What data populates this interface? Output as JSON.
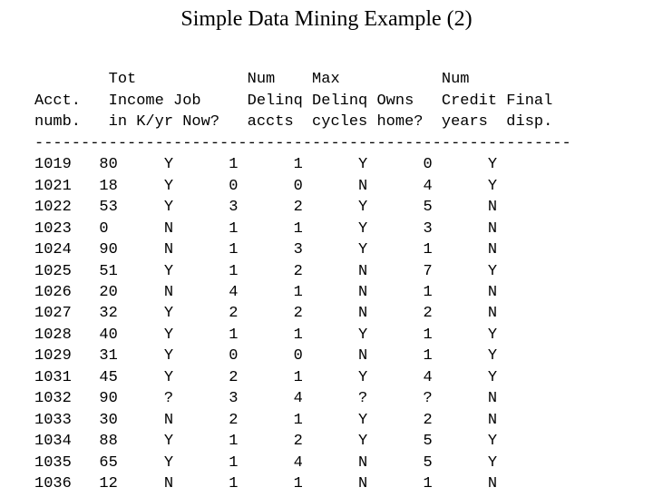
{
  "title": "Simple Data Mining Example (2)",
  "headers": {
    "l1": "        Tot            Num    Max           Num",
    "l2": "Acct.   Income Job     Delinq Delinq Owns   Credit Final",
    "l3": "numb.   in K/yr Now?   accts  cycles home?  years  disp."
  },
  "sep": "----------------------------------------------------------",
  "rows": [
    "1019   80     Y      1      1      Y      0      Y",
    "1021   18     Y      0      0      N      4      Y",
    "1022   53     Y      3      2      Y      5      N",
    "1023   0      N      1      1      Y      3      N",
    "1024   90     N      1      3      Y      1      N",
    "1025   51     Y      1      2      N      7      Y",
    "1026   20     N      4      1      N      1      N",
    "1027   32     Y      2      2      N      2      N",
    "1028   40     Y      1      1      Y      1      Y",
    "1029   31     Y      0      0      N      1      Y",
    "1031   45     Y      2      1      Y      4      Y",
    "1032   90     ?      3      4      ?      ?      N",
    "1033   30     N      2      1      Y      2      N",
    "1034   88     Y      1      2      Y      5      Y",
    "1035   65     Y      1      4      N      5      Y",
    "1036   12     N      1      1      N      1      N"
  ],
  "chart_data": {
    "type": "table",
    "title": "Simple Data Mining Example (2)",
    "columns": [
      "Acct. numb.",
      "Tot Income in K/yr",
      "Job Now?",
      "Num Delinq accts",
      "Max Delinq cycles",
      "Owns home?",
      "Num Credit years",
      "Final disp."
    ],
    "data": [
      [
        1019,
        80,
        "Y",
        1,
        1,
        "Y",
        0,
        "Y"
      ],
      [
        1021,
        18,
        "Y",
        0,
        0,
        "N",
        4,
        "Y"
      ],
      [
        1022,
        53,
        "Y",
        3,
        2,
        "Y",
        5,
        "N"
      ],
      [
        1023,
        0,
        "N",
        1,
        1,
        "Y",
        3,
        "N"
      ],
      [
        1024,
        90,
        "N",
        1,
        3,
        "Y",
        1,
        "N"
      ],
      [
        1025,
        51,
        "Y",
        1,
        2,
        "N",
        7,
        "Y"
      ],
      [
        1026,
        20,
        "N",
        4,
        1,
        "N",
        1,
        "N"
      ],
      [
        1027,
        32,
        "Y",
        2,
        2,
        "N",
        2,
        "N"
      ],
      [
        1028,
        40,
        "Y",
        1,
        1,
        "Y",
        1,
        "Y"
      ],
      [
        1029,
        31,
        "Y",
        0,
        0,
        "N",
        1,
        "Y"
      ],
      [
        1031,
        45,
        "Y",
        2,
        1,
        "Y",
        4,
        "Y"
      ],
      [
        1032,
        90,
        "?",
        3,
        4,
        "?",
        "?",
        "N"
      ],
      [
        1033,
        30,
        "N",
        2,
        1,
        "Y",
        2,
        "N"
      ],
      [
        1034,
        88,
        "Y",
        1,
        2,
        "Y",
        5,
        "Y"
      ],
      [
        1035,
        65,
        "Y",
        1,
        4,
        "N",
        5,
        "Y"
      ],
      [
        1036,
        12,
        "N",
        1,
        1,
        "N",
        1,
        "N"
      ]
    ]
  }
}
